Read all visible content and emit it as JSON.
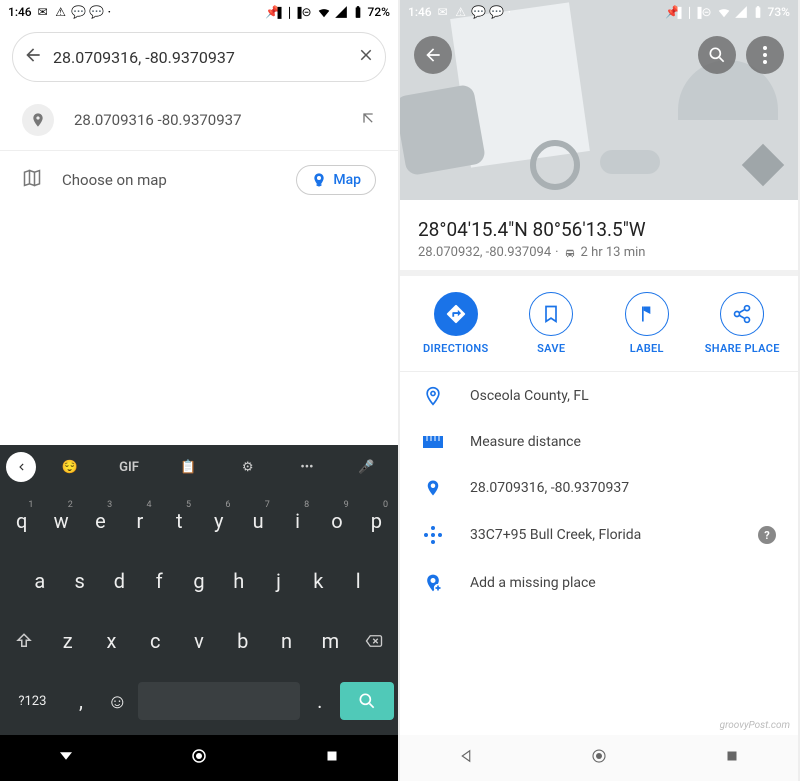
{
  "left": {
    "status": {
      "time": "1:46",
      "battery": "72%"
    },
    "search": {
      "value": "28.0709316, -80.9370937"
    },
    "suggestion": {
      "text": "28.0709316 -80.9370937"
    },
    "choose": {
      "label": "Choose on map",
      "button": "Map"
    },
    "keyboard": {
      "top": {
        "gif": "GIF"
      },
      "row1": [
        "q",
        "w",
        "e",
        "r",
        "t",
        "y",
        "u",
        "i",
        "o",
        "p"
      ],
      "row1s": [
        "1",
        "2",
        "3",
        "4",
        "5",
        "6",
        "7",
        "8",
        "9",
        "0"
      ],
      "row2": [
        "a",
        "s",
        "d",
        "f",
        "g",
        "h",
        "j",
        "k",
        "l"
      ],
      "row3": [
        "z",
        "x",
        "c",
        "v",
        "b",
        "n",
        "m"
      ],
      "sym": "?123",
      "comma": ",",
      "period": "."
    }
  },
  "right": {
    "status": {
      "time": "1:46",
      "battery": "73%"
    },
    "card": {
      "title": "28°04'15.4\"N 80°56'13.5\"W",
      "coords": "28.070932, -80.937094",
      "eta": "2 hr 13 min"
    },
    "actions": {
      "directions": "DIRECTIONS",
      "save": "SAVE",
      "label": "LABEL",
      "share": "SHARE PLACE"
    },
    "info": {
      "loc": "Osceola County, FL",
      "measure": "Measure distance",
      "coords": "28.0709316, -80.9370937",
      "plus": "33C7+95 Bull Creek, Florida",
      "add": "Add a missing place"
    },
    "watermark": "groovyPost.com"
  }
}
